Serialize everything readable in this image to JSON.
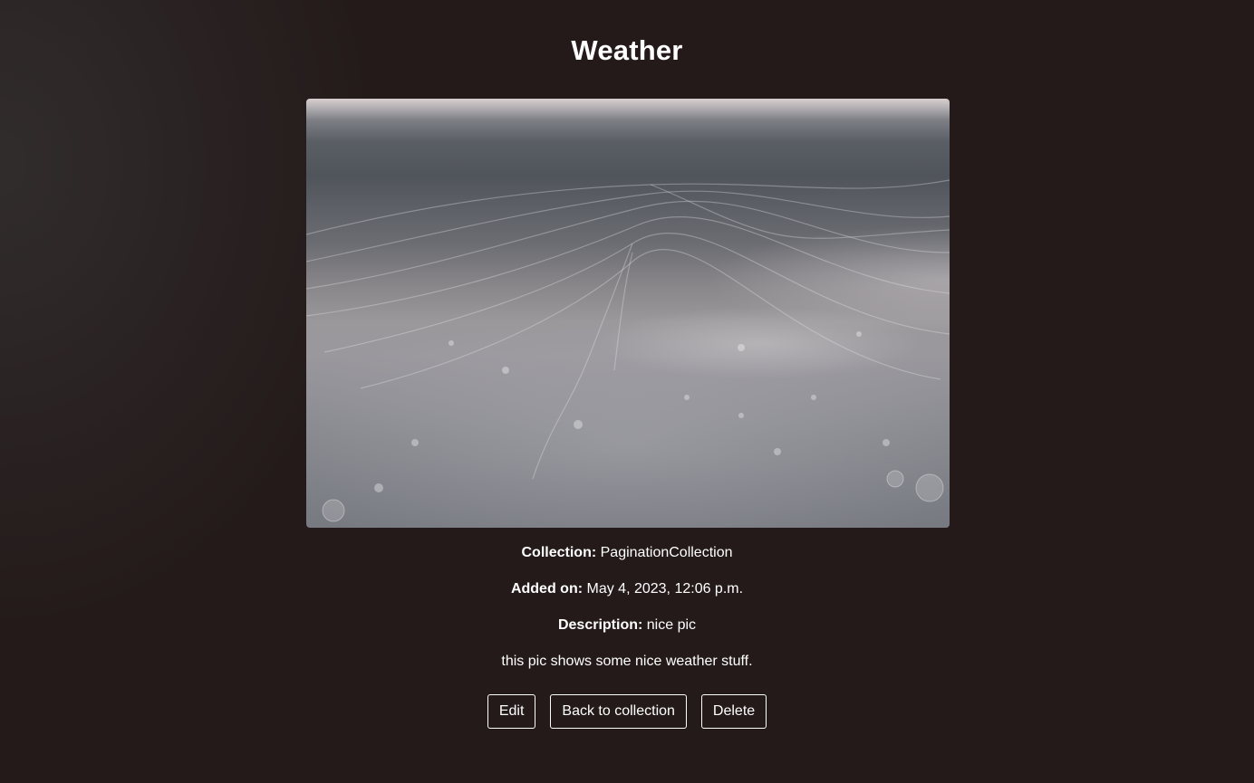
{
  "page": {
    "title": "Weather"
  },
  "photo": {
    "alt": "Weather"
  },
  "details": {
    "collection_label": "Collection:",
    "collection_value": "PaginationCollection",
    "added_label": "Added on:",
    "added_value": "May 4, 2023, 12:06 p.m.",
    "description_label": "Description:",
    "description_value": "nice pic",
    "body_text": "this pic shows some nice weather stuff."
  },
  "actions": {
    "edit_label": "Edit",
    "back_label": "Back to collection",
    "delete_label": "Delete"
  },
  "colors": {
    "background": "#241a1a",
    "text": "#ffffff",
    "button_border": "#ffffff"
  }
}
